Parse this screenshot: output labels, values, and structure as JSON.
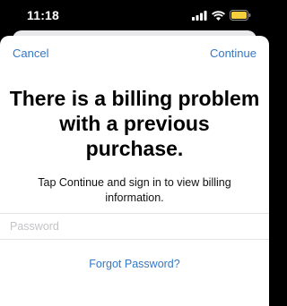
{
  "status_bar": {
    "time": "11:18",
    "icons": [
      "cellular-signal-icon",
      "wifi-icon",
      "battery-icon"
    ],
    "battery_color": "#f4d03f"
  },
  "nav": {
    "cancel_label": "Cancel",
    "continue_label": "Continue"
  },
  "dialog": {
    "title": "There is a billing problem with a previous purchase.",
    "message": "Tap Continue and sign in to view billing information."
  },
  "password": {
    "value": "",
    "placeholder": "Password"
  },
  "forgot_password_label": "Forgot Password?",
  "colors": {
    "accent": "#3478c6",
    "background": "#ffffff",
    "status_bar": "#000000"
  }
}
